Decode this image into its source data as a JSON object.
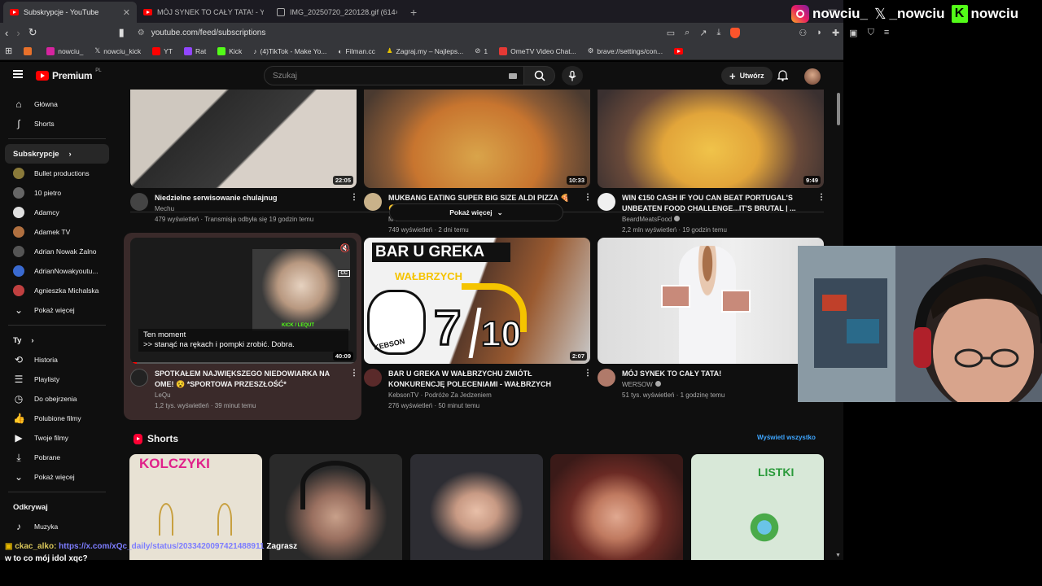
{
  "tabs": [
    {
      "title": "Subskrypcje - YouTube",
      "icon": "youtube-icon",
      "active": true
    },
    {
      "title": "MÓJ SYNEK TO CAŁY TATA! - YouTube",
      "icon": "youtube-icon",
      "active": false
    },
    {
      "title": "IMG_20250720_220128.gif (614×694)",
      "icon": "image-icon",
      "active": false
    }
  ],
  "address": {
    "url": "youtube.com/feed/subscriptions",
    "shield_count": "37"
  },
  "bookmarks": [
    "",
    "nowciu_",
    "nowciu_kick",
    "YT",
    "Rat",
    "Kick",
    "(4)TikTok - Make Yo...",
    "Filman.cc",
    "Zagraj.my – Najleps...",
    "1",
    "OmeTV Video Chat...",
    "brave://settings/con...",
    ""
  ],
  "yt": {
    "logo": "Premium",
    "region": "PL",
    "search_placeholder": "Szukaj",
    "create_label": "Utwórz"
  },
  "sidebar": {
    "main": [
      {
        "label": "Główna",
        "icon": "home-icon"
      },
      {
        "label": "Shorts",
        "icon": "shorts-icon"
      }
    ],
    "subs_heading": "Subskrypcje",
    "subs": [
      {
        "label": "Bullet productions",
        "color": "#8a7a3a"
      },
      {
        "label": "10 pietro",
        "color": "#666666"
      },
      {
        "label": "Adamcy",
        "color": "#e0e0e0"
      },
      {
        "label": "Adamek TV",
        "color": "#b07040"
      },
      {
        "label": "Adrian Nowak Żalno",
        "color": "#555555"
      },
      {
        "label": "AdrianNowakyoutu...",
        "color": "#3a6ad0"
      },
      {
        "label": "Agnieszka Michalska",
        "color": "#c04040"
      }
    ],
    "subs_more": "Pokaż więcej",
    "you_heading": "Ty",
    "you": [
      {
        "label": "Historia",
        "icon": "history-icon"
      },
      {
        "label": "Playlisty",
        "icon": "playlist-icon"
      },
      {
        "label": "Do obejrzenia",
        "icon": "clock-icon"
      },
      {
        "label": "Polubione filmy",
        "icon": "like-icon"
      },
      {
        "label": "Twoje filmy",
        "icon": "video-icon"
      },
      {
        "label": "Pobrane",
        "icon": "download-icon"
      }
    ],
    "you_more": "Pokaż więcej",
    "explore_heading": "Odkrywaj",
    "explore": [
      {
        "label": "Muzyka",
        "icon": "music-icon"
      }
    ]
  },
  "row1": [
    {
      "title1": "Niedzielne serwisowanie chulajnug",
      "title2": "",
      "channel": "Mechu",
      "stats": "479 wyświetleń · Transmisja odbyła się 19 godzin temu",
      "duration": "22:05",
      "verified": false
    },
    {
      "title1": "MUKBANG EATING SUPER BIG SIZE ALDI PIZZA 🍕",
      "title2": "😁",
      "channel": "M and K EATS ASMR",
      "stats": "749 wyświetleń · 2 dni temu",
      "duration": "10:33",
      "verified": false
    },
    {
      "title1": "WIN €150 CASH IF YOU CAN BEAT PORTUGAL'S",
      "title2": "UNBEATEN FOOD CHALLENGE...IT'S BRUTAL | ...",
      "channel": "BeardMeatsFood",
      "stats": "2,2 mln wyświetleń · 19 godzin temu",
      "duration": "9:49",
      "verified": true
    }
  ],
  "show_more": "Pokaż więcej",
  "row2": [
    {
      "title1": "SPOTKAŁEM NAJWIĘKSZEGO NIEDOWIARKA NA",
      "title2": "OME! 😵 *SPORTOWA PRZESZŁOŚĆ*",
      "channel": "LeQu",
      "stats": "1,2 tys. wyświetleń · 39 minut temu",
      "duration": "40:09",
      "verified": false
    },
    {
      "title1": "BAR U GREKA W WAŁBRZYCHU ZMIÓTŁ",
      "title2": "KONKURENCJĘ POLECENIAMI - WAŁBRZYCH",
      "channel": "KebsonTV · Podróże Za Jedzeniem",
      "stats": "276 wyświetleń · 50 minut temu",
      "duration": "2:07",
      "verified": false
    },
    {
      "title1": "MÓJ SYNEK TO CAŁY TATA!",
      "title2": "",
      "channel": "WERSOW",
      "stats": "51 tys. wyświetleń · 1 godzinę temu",
      "duration": "",
      "verified": true
    }
  ],
  "preview": {
    "caption1": "Ten moment",
    "caption2": ">> stanąć na rękach i pompki zrobić. Dobra.",
    "overlay_tag": "KICK / LEQUT"
  },
  "thumb_bar": {
    "line1": "BAR U GREKA",
    "line2": "WAŁBRZYCH",
    "score_a": "7",
    "score_b": "10",
    "tag": "KEBSON"
  },
  "shorts": {
    "heading": "Shorts",
    "view_all": "Wyświetl wszystko",
    "items": [
      {
        "text": "KOLCZYKI",
        "bg": "#e8e2d4"
      },
      {
        "text": "",
        "bg": "#3a3535"
      },
      {
        "text": "",
        "bg": "#2d2d33"
      },
      {
        "text": "",
        "bg": "#5a2a24"
      },
      {
        "text": "LISTKI",
        "bg": "#d8e8d8"
      }
    ]
  },
  "socials": {
    "instagram": "nowciu_",
    "x": "_nowciu",
    "kick": "nowciu"
  },
  "chat": {
    "user": "ckac_alko",
    "link": "https://x.com/xQc_daily/status/2033420097421488911",
    "text1": "Zagrasz",
    "text2": "w to co mój idol xqc?"
  }
}
